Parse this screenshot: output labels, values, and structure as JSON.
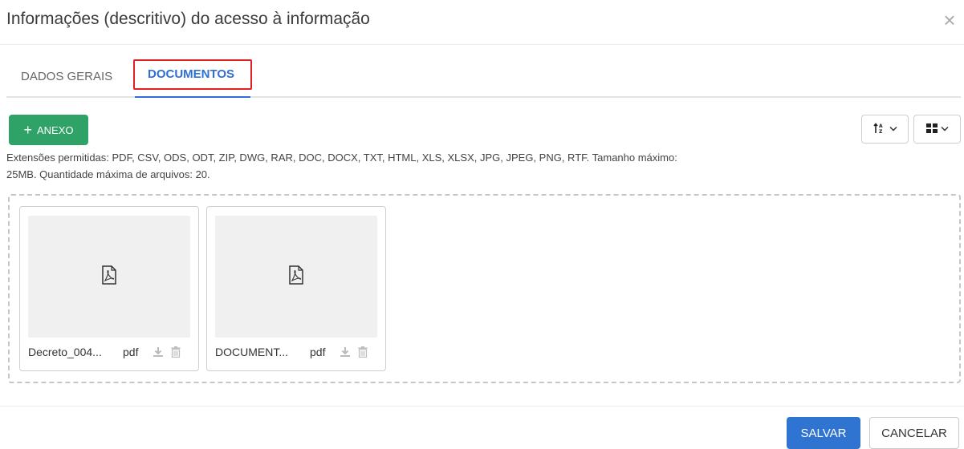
{
  "modal": {
    "title": "Informações (descritivo) do acesso à informação",
    "close_icon": "close-icon"
  },
  "tabs": [
    {
      "label": "DADOS GERAIS",
      "active": false
    },
    {
      "label": "DOCUMENTOS",
      "active": true
    }
  ],
  "toolbar": {
    "add_label": "ANEXO",
    "add_icon": "plus-icon",
    "sort_icon": "sort-alpha-icon",
    "view_icon": "grid-view-icon"
  },
  "hint": "Extensões permitidas: PDF, CSV, ODS, ODT, ZIP, DWG, RAR, DOC, DOCX, TXT, HTML, XLS, XLSX, JPG, JPEG, PNG, RTF. Tamanho máximo: 25MB. Quantidade máxima de arquivos: 20.",
  "files": [
    {
      "name": "Decreto_004...",
      "ext": "pdf",
      "icon": "pdf-file-icon"
    },
    {
      "name": "DOCUMENT...",
      "ext": "pdf",
      "icon": "pdf-file-icon"
    }
  ],
  "footer": {
    "save_label": "SALVAR",
    "cancel_label": "CANCELAR"
  },
  "colors": {
    "accent": "#2f6fd5",
    "add_button": "#2fa267",
    "save_button": "#2f74d0",
    "highlight": "#e02020"
  }
}
